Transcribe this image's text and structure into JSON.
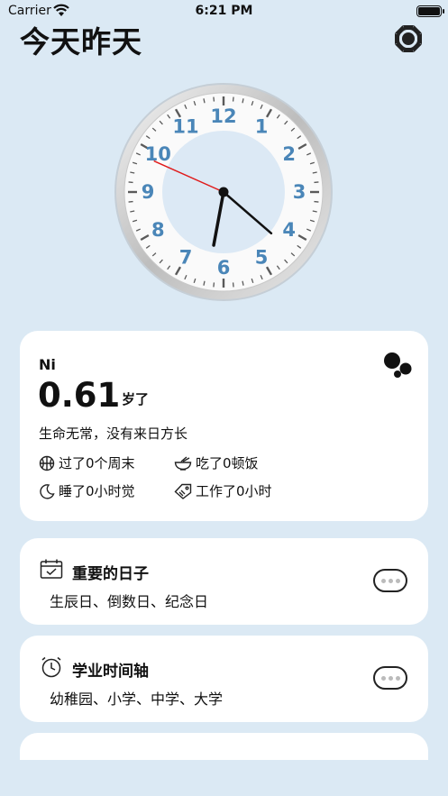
{
  "status": {
    "carrier": "Carrier",
    "time": "6:21 PM"
  },
  "header": {
    "title": "今天昨天"
  },
  "clock": {
    "time": "6:21",
    "hour": 6,
    "minute": 21,
    "second": 49,
    "numerals": [
      "12",
      "1",
      "2",
      "3",
      "4",
      "5",
      "6",
      "7",
      "8",
      "9",
      "10",
      "11"
    ]
  },
  "profile": {
    "name": "Ni",
    "age": "0.61",
    "age_unit": "岁了",
    "motto": "生命无常，没有来日方长",
    "stats": [
      {
        "label": "过了0个周末",
        "icon": "basketball-icon"
      },
      {
        "label": "吃了0顿饭",
        "icon": "bowl-icon"
      },
      {
        "label": "睡了0小时觉",
        "icon": "moon-icon"
      },
      {
        "label": "工作了0小时",
        "icon": "ticket-icon"
      }
    ]
  },
  "sections": [
    {
      "title": "重要的日子",
      "subtitle": "生辰日、倒数日、纪念日",
      "icon": "calendar-icon"
    },
    {
      "title": "学业时间轴",
      "subtitle": "幼稚园、小学、中学、大学",
      "icon": "alarm-clock-icon"
    }
  ]
}
